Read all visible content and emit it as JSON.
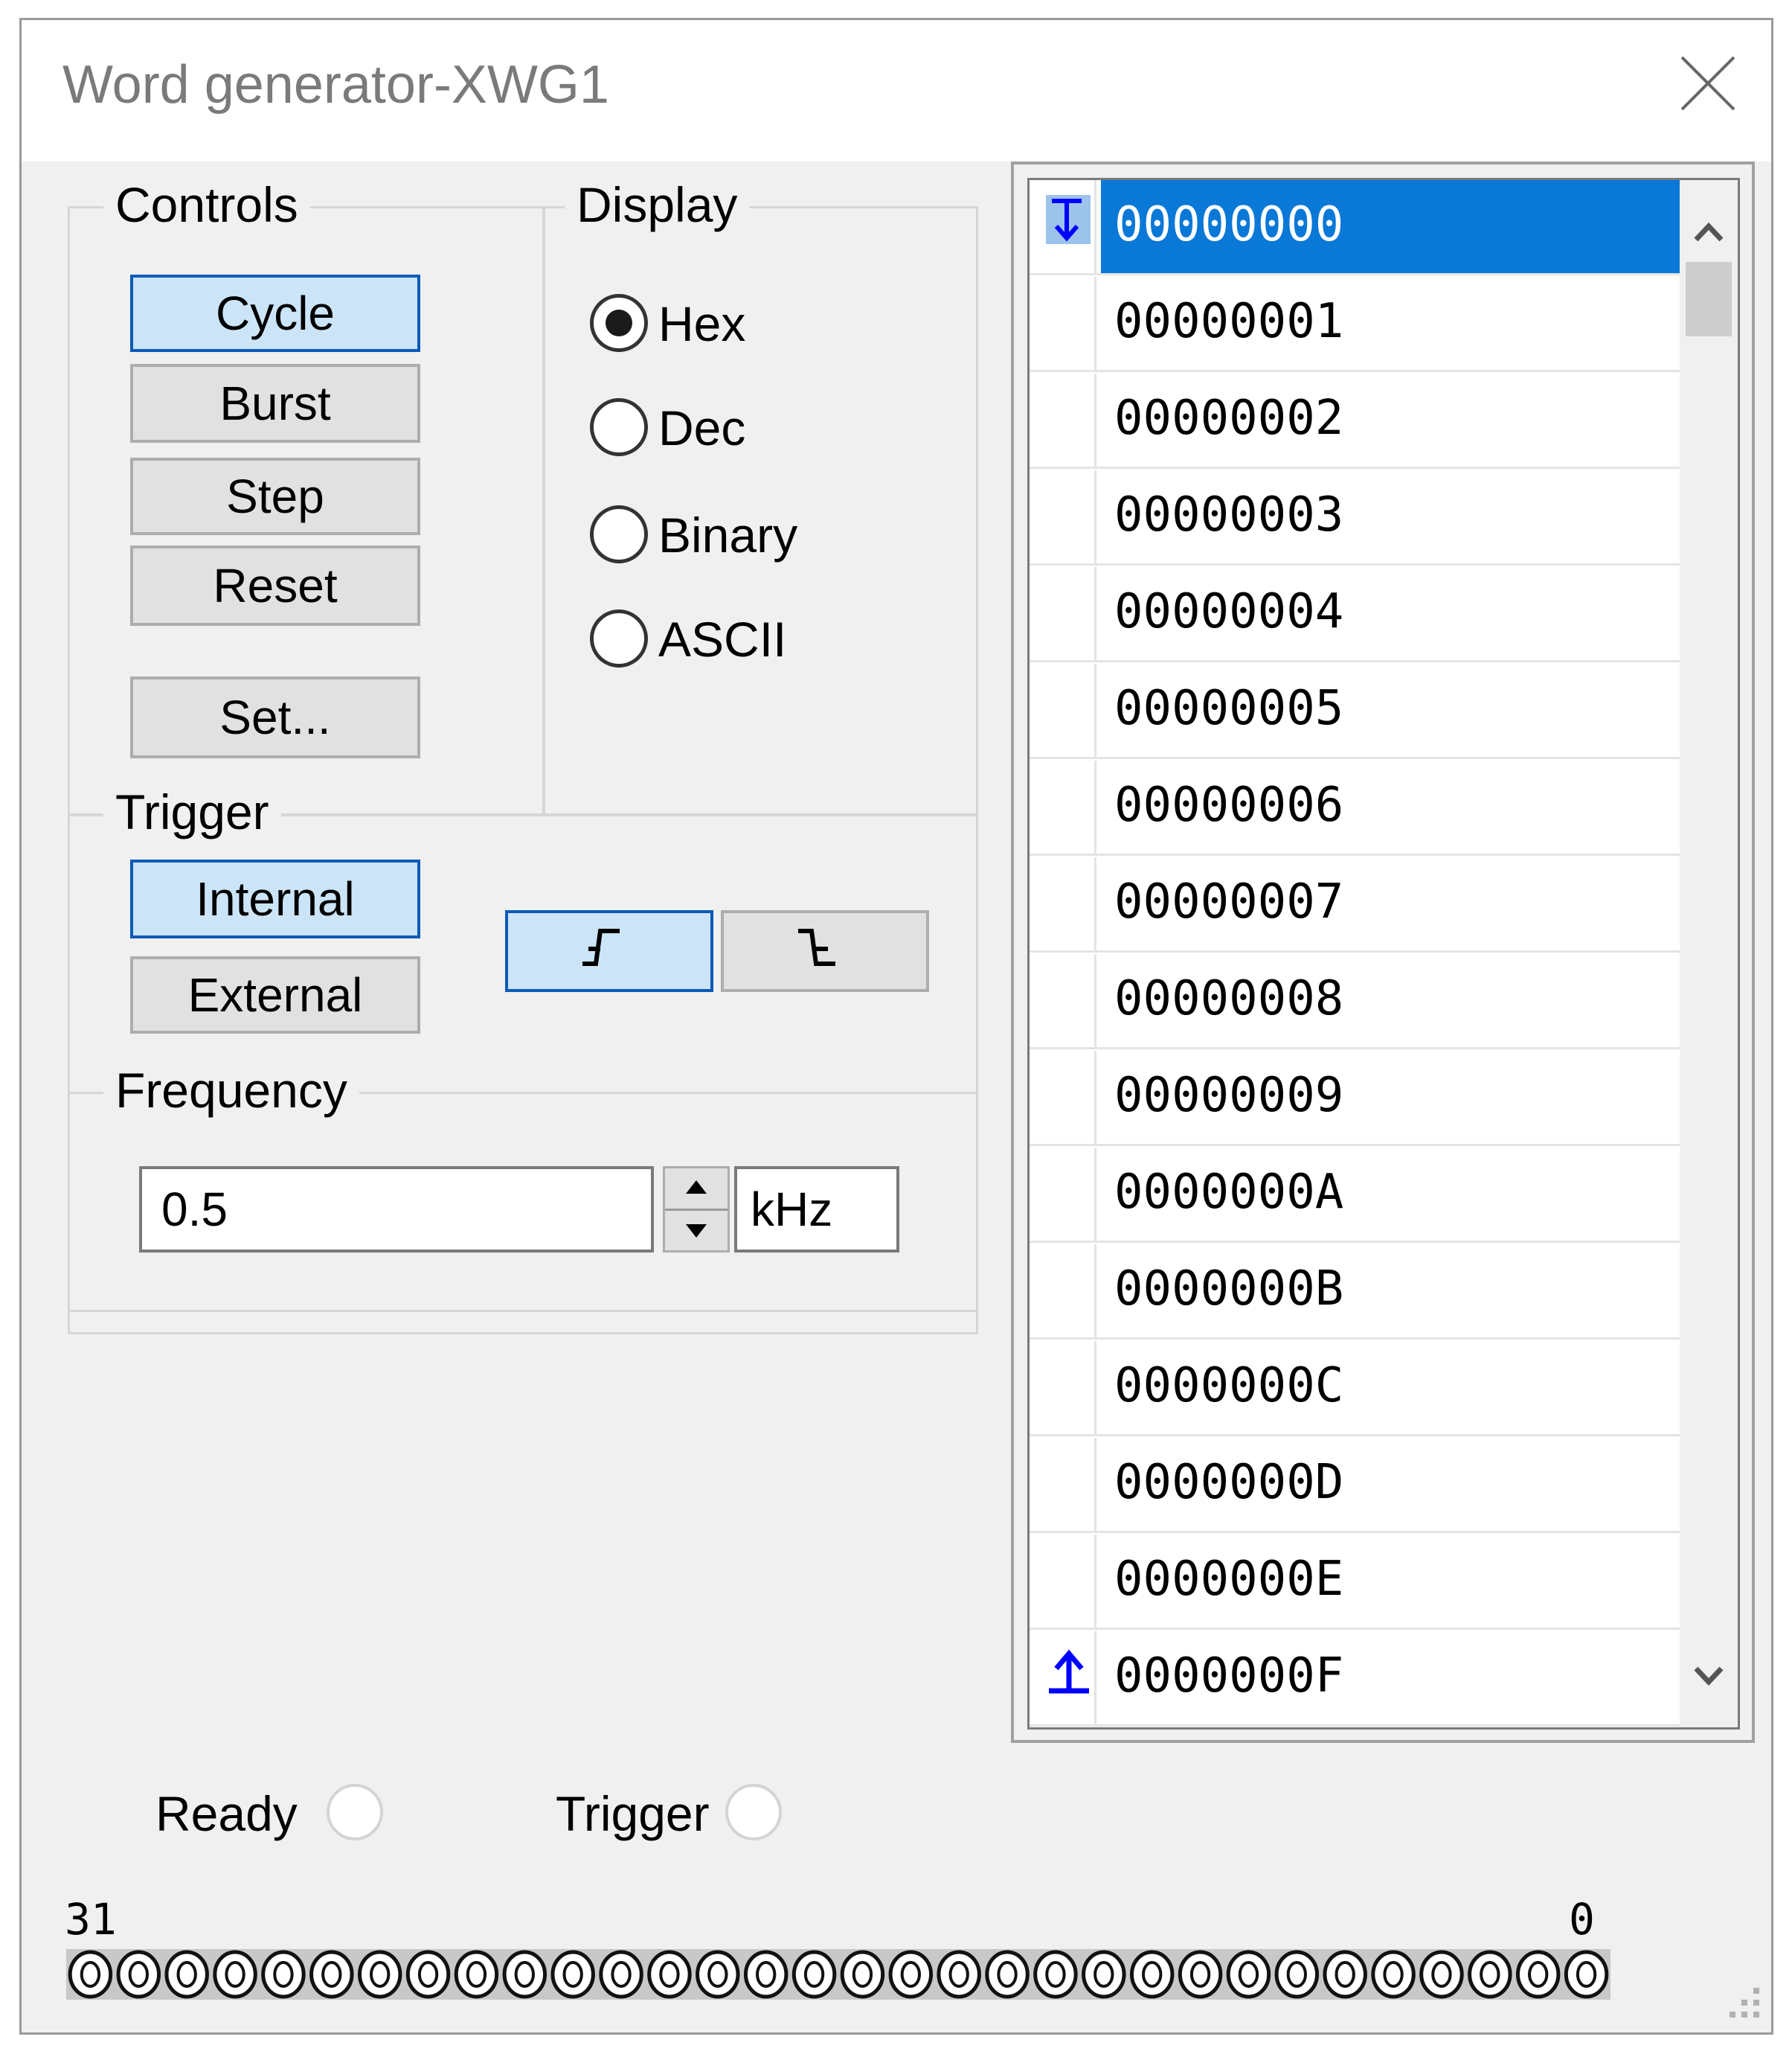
{
  "window": {
    "title": "Word generator-XWG1"
  },
  "controls": {
    "group_label": "Controls",
    "cycle": "Cycle",
    "burst": "Burst",
    "step": "Step",
    "reset": "Reset",
    "set": "Set..."
  },
  "display": {
    "group_label": "Display",
    "options": [
      "Hex",
      "Dec",
      "Binary",
      "ASCII"
    ],
    "selected": "Hex"
  },
  "trigger": {
    "group_label": "Trigger",
    "internal": "Internal",
    "external": "External",
    "selected_source": "Internal",
    "selected_edge": "rising"
  },
  "frequency": {
    "group_label": "Frequency",
    "value": "0.5",
    "unit": "kHz"
  },
  "words": [
    "00000000",
    "00000001",
    "00000002",
    "00000003",
    "00000004",
    "00000005",
    "00000006",
    "00000007",
    "00000008",
    "00000009",
    "0000000A",
    "0000000B",
    "0000000C",
    "0000000D",
    "0000000E",
    "0000000F"
  ],
  "selected_word_index": 0,
  "status": {
    "ready": "Ready",
    "trigger": "Trigger"
  },
  "bits": {
    "high_label": "31",
    "low_label": "0",
    "count": 32,
    "values": "00000000000000000000000000000000"
  },
  "colors": {
    "accent": "#0a78d7",
    "selected_button": "#cce4f7",
    "marker_blue": "#0000ff"
  }
}
